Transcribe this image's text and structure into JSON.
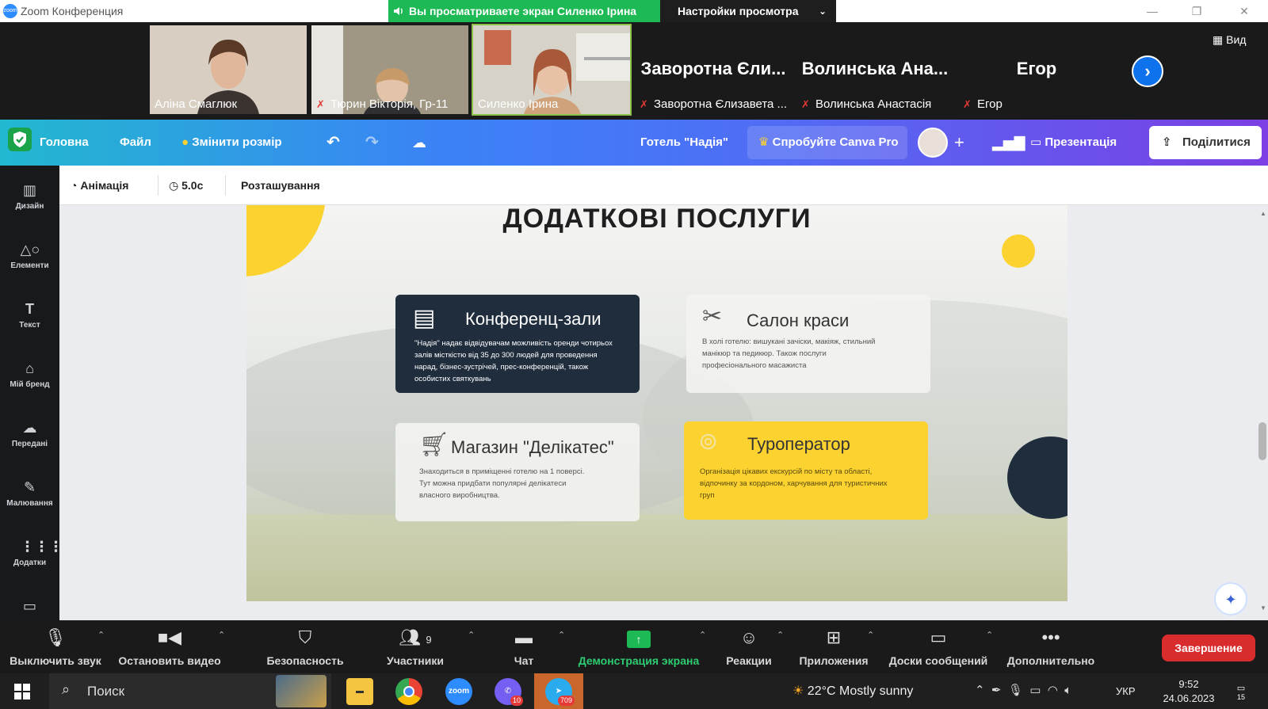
{
  "window": {
    "title": "Zoom Конференция",
    "share_banner": "Вы просматриваете экран Силенко Ірина",
    "view_settings": "Настройки просмотра",
    "view_label": "Вид"
  },
  "participants": [
    {
      "name": "Аліна Смаглюк",
      "muted": false,
      "video": true
    },
    {
      "name": "Тюрин Вікторія, Гр-11",
      "muted": true,
      "video": true
    },
    {
      "name": "Силенко Ірина",
      "muted": false,
      "video": true,
      "active": true
    },
    {
      "name": "Заворотна Єлизавета ...",
      "display": "Заворотна Єли...",
      "muted": true,
      "video": false
    },
    {
      "name": "Волинська Анастасія",
      "display": "Волинська Ана...",
      "muted": true,
      "video": false
    },
    {
      "name": "Егор",
      "display": "Егор",
      "muted": true,
      "video": false
    }
  ],
  "canva": {
    "home": "Головна",
    "file": "Файл",
    "resize": "Змінити розмір",
    "doc_title": "Готель \"Надія\"",
    "try_pro": "Спробуйте Canva Pro",
    "presentation": "Презентація",
    "share": "Поділитися",
    "sidebar": [
      {
        "label": "Дизайн",
        "icon": "layout-icon"
      },
      {
        "label": "Елементи",
        "icon": "shapes-icon"
      },
      {
        "label": "Текст",
        "icon": "text-icon"
      },
      {
        "label": "Мій бренд",
        "icon": "brand-icon"
      },
      {
        "label": "Передані",
        "icon": "upload-icon"
      },
      {
        "label": "Малювання",
        "icon": "draw-icon"
      },
      {
        "label": "Додатки",
        "icon": "apps-icon"
      }
    ],
    "subbar": {
      "animation": "Анімація",
      "duration": "5.0с",
      "position": "Розташування"
    }
  },
  "slide": {
    "title": "ДОДАТКОВІ ПОСЛУГИ",
    "cards": [
      {
        "title": "Конференц-зали",
        "desc": "\"Надія\" надає відвідувачам можливість оренди чотирьох залів місткістю від 35 до 300 людей для проведення нарад, бізнес-зустрічей, прес-конференцій, також особистих святкувань"
      },
      {
        "title": "Салон краси",
        "desc": "В холі готелю: вишукані зачіски, макіяж, стильний манікюр та педикюр. Також послуги професіонального масажиста"
      },
      {
        "title": "Магазин \"Делікатес\"",
        "desc": "Знаходиться в приміщенні готелю на 1 поверсі. Тут можна придбати популярні делікатеси власного виробництва."
      },
      {
        "title": "Туроператор",
        "desc": "Організація цікавих екскурсій по місту та області, відпочинку за кордоном, харчування для туристичних груп"
      }
    ]
  },
  "zoom_toolbar": {
    "mute": "Выключить звук",
    "video": "Остановить видео",
    "security": "Безопасность",
    "participants": "Участники",
    "participants_count": "9",
    "chat": "Чат",
    "share_screen": "Демонстрация экрана",
    "reactions": "Реакции",
    "apps": "Приложения",
    "whiteboards": "Доски сообщений",
    "more": "Дополнительно",
    "end": "Завершение"
  },
  "taskbar": {
    "search": "Поиск",
    "viber_badge": "10",
    "telegram_badge": "709",
    "weather": "22°C  Mostly sunny",
    "lang": "УКР",
    "time": "9:52",
    "date": "24.06.2023",
    "notifications": "15"
  },
  "colors": {
    "share_banner": "#1db954",
    "end_button": "#d92d2d",
    "slide_yellow": "#fbd22f",
    "slide_navy": "#1f2d3d",
    "zoom_blue": "#0e72ed"
  }
}
